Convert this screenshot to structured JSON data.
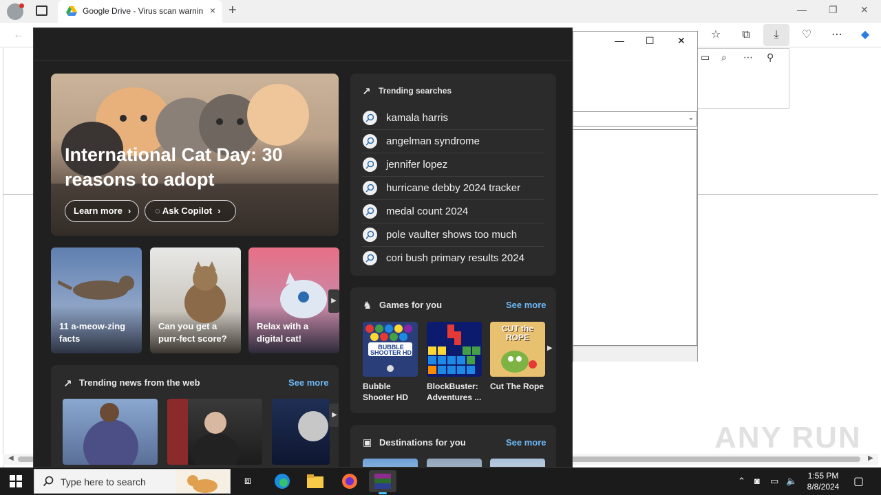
{
  "browser": {
    "tab_title": "Google Drive - Virus scan warning",
    "new_tab_symbol": "+",
    "tab_close_symbol": "×"
  },
  "hero": {
    "title": "International Cat Day: 30 reasons to adopt",
    "learn_more": "Learn more",
    "ask_copilot": "Ask Copilot"
  },
  "cards": [
    {
      "label": "11 a-meow-zing facts"
    },
    {
      "label": "Can you get a purr-fect score?"
    },
    {
      "label": "Relax with a digital cat!"
    }
  ],
  "trending": {
    "title": "Trending searches",
    "items": [
      "kamala harris",
      "angelman syndrome",
      "jennifer lopez",
      "hurricane debby 2024 tracker",
      "medal count 2024",
      "pole vaulter shows too much",
      "cori bush primary results 2024"
    ]
  },
  "news": {
    "title": "Trending news from the web",
    "see_more": "See more"
  },
  "games": {
    "title": "Games for you",
    "see_more": "See more",
    "items": [
      {
        "name": "Bubble Shooter HD",
        "tile_text": "BUBBLE SHOOTER HD"
      },
      {
        "name": "BlockBuster: Adventures ..."
      },
      {
        "name": "Cut The Rope",
        "tile_text": "CUT the ROPE"
      }
    ]
  },
  "destinations": {
    "title": "Destinations for you",
    "see_more": "See more"
  },
  "taskbar": {
    "search_placeholder": "Type here to search",
    "time": "1:55 PM",
    "date": "8/8/2024"
  },
  "watermark": "ANY RUN",
  "colors": {
    "panel_bg": "#202020",
    "card_bg": "#2b2b2b",
    "link": "#6cb8f6",
    "taskbar": "#1b1b1b",
    "accent": "#4cc2ff"
  }
}
